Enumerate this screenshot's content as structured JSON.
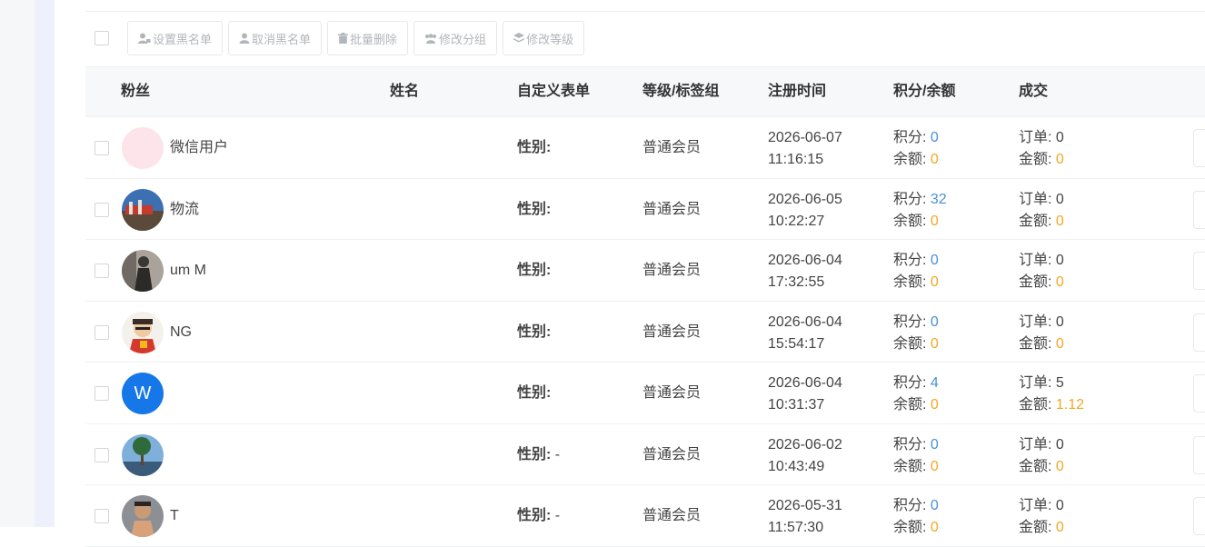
{
  "toolbar": {
    "buttons": [
      {
        "label": "设置黑名单",
        "icon": "user-lock-icon"
      },
      {
        "label": "取消黑名单",
        "icon": "user-icon"
      },
      {
        "label": "批量删除",
        "icon": "trash-icon"
      },
      {
        "label": "修改分组",
        "icon": "users-icon"
      },
      {
        "label": "修改等级",
        "icon": "layers-icon"
      }
    ]
  },
  "table": {
    "headers": {
      "fans": "粉丝",
      "name": "姓名",
      "form": "自定义表单",
      "level": "等级/标签组",
      "reg_time": "注册时间",
      "points": "积分/余额",
      "deal": "成交"
    },
    "labels": {
      "gender": "性别:",
      "points": "积分:",
      "balance": "余额:",
      "orders": "订单:",
      "amount": "金额:"
    },
    "rows": [
      {
        "nickname": "微信用户",
        "realname": "",
        "gender": "",
        "level": "普通会员",
        "date": "2026-06-07",
        "time": "11:16:15",
        "points": "0",
        "balance": "0",
        "orders": "0",
        "amount": "0",
        "avatar": "pink"
      },
      {
        "nickname": "物流",
        "realname": "",
        "gender": "",
        "level": "普通会员",
        "date": "2026-06-05",
        "time": "10:22:27",
        "points": "32",
        "balance": "0",
        "orders": "0",
        "amount": "0",
        "avatar": "scene"
      },
      {
        "nickname": "um M",
        "realname": "",
        "gender": "",
        "level": "普通会员",
        "date": "2026-06-04",
        "time": "17:32:55",
        "points": "0",
        "balance": "0",
        "orders": "0",
        "amount": "0",
        "avatar": "person"
      },
      {
        "nickname": "NG",
        "realname": "",
        "gender": "",
        "level": "普通会员",
        "date": "2026-06-04",
        "time": "15:54:17",
        "points": "0",
        "balance": "0",
        "orders": "0",
        "amount": "0",
        "avatar": "cartoon"
      },
      {
        "nickname": "",
        "realname": "",
        "gender": "",
        "level": "普通会员",
        "date": "2026-06-04",
        "time": "10:31:37",
        "points": "4",
        "balance": "0",
        "orders": "5",
        "amount": "1.12",
        "avatar": "letter",
        "avatar_letter": "W"
      },
      {
        "nickname": "",
        "realname": "",
        "gender": "-",
        "level": "普通会员",
        "date": "2026-06-02",
        "time": "10:43:49",
        "points": "0",
        "balance": "0",
        "orders": "0",
        "amount": "0",
        "avatar": "tree"
      },
      {
        "nickname": "T",
        "realname": "",
        "gender": "-",
        "level": "普通会员",
        "date": "2026-05-31",
        "time": "11:57:30",
        "points": "0",
        "balance": "0",
        "orders": "0",
        "amount": "0",
        "avatar": "portrait"
      }
    ]
  },
  "colors": {
    "points": "#4a90d9",
    "balance": "#f5a623",
    "avatar_letter_bg": "#1677e8"
  }
}
